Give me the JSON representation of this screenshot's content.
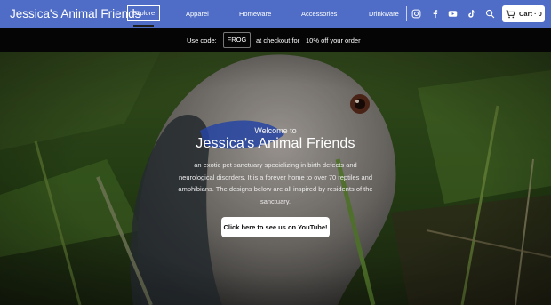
{
  "header": {
    "brand": "Jessica's Animal Friends",
    "nav": [
      {
        "label": "Explore"
      },
      {
        "label": "Apparel"
      },
      {
        "label": "Homeware"
      },
      {
        "label": "Accessories"
      },
      {
        "label": "Drinkware"
      }
    ],
    "social_icons": [
      "instagram-icon",
      "facebook-icon",
      "youtube-icon",
      "tiktok-icon",
      "search-icon"
    ],
    "cart_label": "Cart · 0"
  },
  "promo": {
    "prefix": "Use code:",
    "code": "FROG",
    "middle": "at checkout for",
    "link": "10% off your order"
  },
  "hero": {
    "welcome": "Welcome to",
    "title": "Jessica's Animal Friends",
    "description": "an exotic pet sanctuary specializing in birth defects and neurological disorders. It is a forever home to over 70 reptiles and amphibians. The designs below are all inspired by residents of the sanctuary.",
    "cta": "Click here to see us on YouTube!"
  },
  "colors": {
    "header_bg": "#4f6dc6",
    "promo_bg": "#050505",
    "button_bg": "#ffffff"
  }
}
